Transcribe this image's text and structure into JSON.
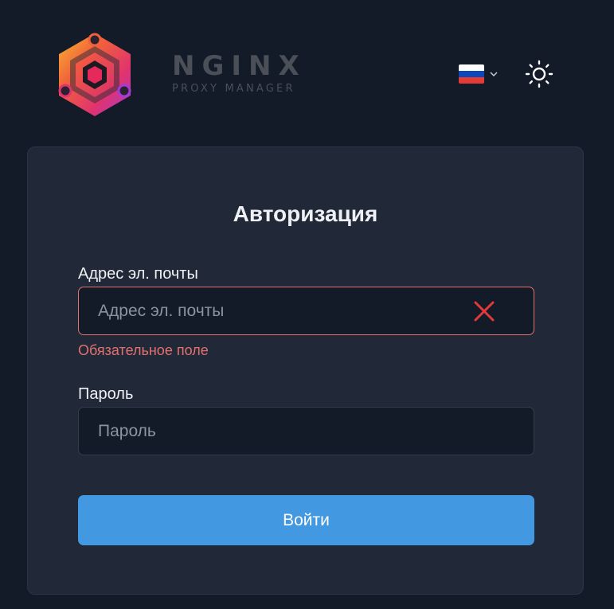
{
  "header": {
    "logo_title": "NGINX",
    "logo_subtitle": "PROXY MANAGER",
    "language": {
      "selected": "ru",
      "flag_colors": [
        "#ffffff",
        "#0c47b7",
        "#e53b35"
      ]
    },
    "theme_icon": "sun-icon"
  },
  "login": {
    "title": "Авторизация",
    "email": {
      "label": "Адрес эл. почты",
      "placeholder": "Адрес эл. почты",
      "value": "",
      "error": "Обязательное поле",
      "state_icon": "invalid-x-icon"
    },
    "password": {
      "label": "Пароль",
      "placeholder": "Пароль",
      "value": ""
    },
    "submit_label": "Войти"
  },
  "colors": {
    "background": "#131a28",
    "card": "#212938",
    "accent": "#4299e1",
    "error": "#e3716f"
  }
}
